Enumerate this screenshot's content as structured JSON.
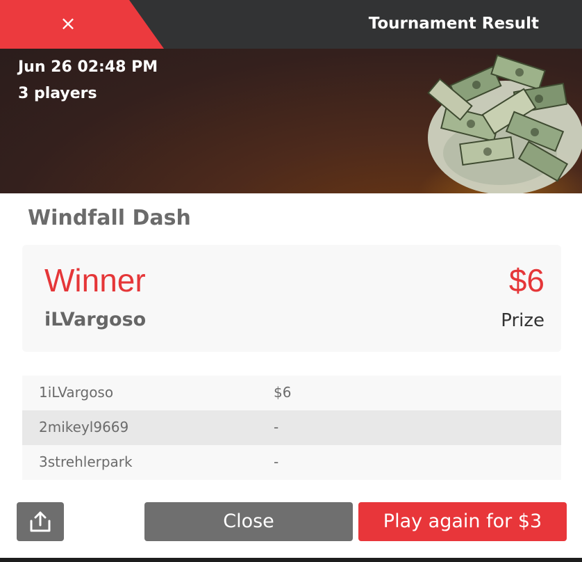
{
  "header": {
    "title": "Tournament Result",
    "close_glyph": "×"
  },
  "banner": {
    "date": "Jun 26 02:48 PM",
    "players": "3 players",
    "image": "money-bag-illustration"
  },
  "tournament": {
    "name": "Windfall Dash"
  },
  "winner": {
    "label": "Winner",
    "name": "iLVargoso",
    "prize": "$6",
    "prize_label": "Prize"
  },
  "results": [
    {
      "rank": "1",
      "player": "iLVargoso",
      "prize": "$6"
    },
    {
      "rank": "2",
      "player": "mikeyl9669",
      "prize": "-"
    },
    {
      "rank": "3",
      "player": "strehlerpark",
      "prize": "-"
    }
  ],
  "footer": {
    "share_icon": "share-icon",
    "close_label": "Close",
    "play_again_label": "Play again for $3"
  },
  "colors": {
    "accent": "#e8363a",
    "header_bg": "#323334",
    "button_gray": "#6f6f6f"
  }
}
